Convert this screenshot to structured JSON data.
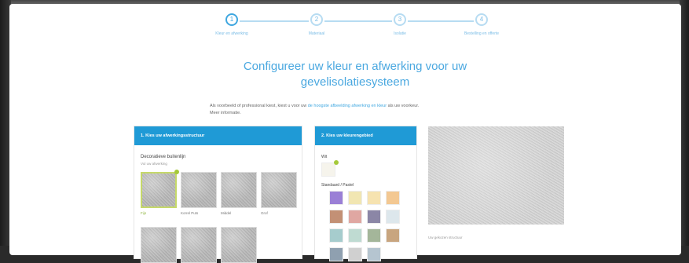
{
  "stepper": {
    "steps": [
      {
        "number": "1",
        "label": "Kleur en afwerking",
        "active": true
      },
      {
        "number": "2",
        "label": "Materiaal",
        "active": false
      },
      {
        "number": "3",
        "label": "Isolatie",
        "active": false
      },
      {
        "number": "4",
        "label": "Bestelling en offerte",
        "active": false
      }
    ]
  },
  "title": "Configureer uw kleur en afwerking voor uw gevelisolatiesysteem",
  "intro": {
    "text_before": "Als voorbeeld of professional kiest, kiest u voor uw",
    "link": "de hoogste afbeelding afwerking en kleur",
    "text_after": "als uw voorkeur.",
    "line2": "Meer informatie."
  },
  "finish_panel": {
    "header": "1. Kies uw afwerkingsstructuur",
    "group_title": "Decoratieve buitenlijn",
    "group_subtitle": "Vul uw afwerking",
    "swatches": [
      {
        "label": "Fijn",
        "selected": true
      },
      {
        "label": "Korrel Puts",
        "selected": false
      },
      {
        "label": "Middel",
        "selected": false
      },
      {
        "label": "Grof",
        "selected": false
      },
      {
        "label": "",
        "selected": false
      },
      {
        "label": "",
        "selected": false
      },
      {
        "label": "",
        "selected": false
      }
    ]
  },
  "color_panel": {
    "header": "2. Kies uw kleurengebied",
    "white_label": "Wit",
    "palette_label": "Standaard / Pastel",
    "chips": [
      "#9a7fd6",
      "#f1e6b2",
      "#f6e3b0",
      "#f3c892",
      "#c39075",
      "#e0a7a2",
      "#8b86a6",
      "#dde7ec",
      "#a6cccd",
      "#bfdbd2",
      "#a4b69a",
      "#c8a57f",
      "#8fa0b0",
      "#d0d0d0",
      "#b5c5d0"
    ]
  },
  "preview": {
    "caption": "Uw gekozen structuur"
  },
  "colors": {
    "accent": "#1f9ad6",
    "title": "#4aa8e0",
    "selected": "#a5c93a"
  }
}
